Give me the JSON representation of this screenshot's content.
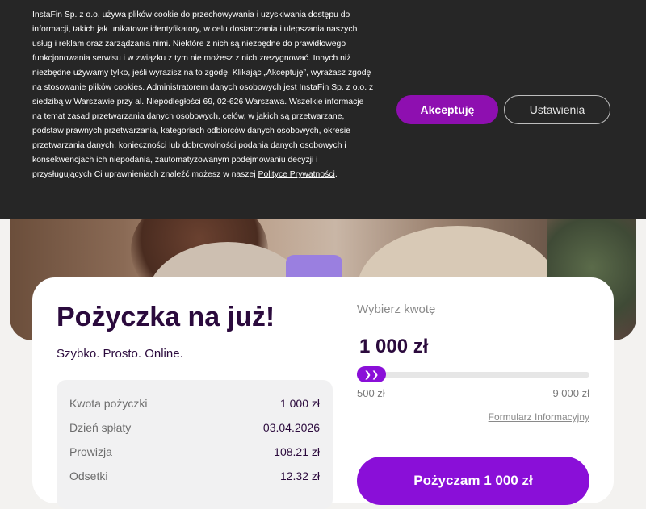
{
  "cookie_banner": {
    "text": "InstaFin Sp. z o.o. używa plików cookie do przechowywania i uzyskiwania dostępu do informacji, takich jak unikatowe identyfikatory, w celu dostarczania i ulepszania naszych usług i reklam oraz zarządzania nimi. Niektóre z nich są niezbędne do prawidłowego funkcjonowania serwisu i w związku z tym nie możesz z nich zrezygnować. Innych niż niezbędne używamy tylko, jeśli wyrazisz na to zgodę. Klikając „Akceptuję”, wyrażasz zgodę na stosowanie plików cookies. Administratorem danych osobowych jest InstaFin Sp. z o.o. z siedzibą w Warszawie przy al. Niepodległości 69, 02-626 Warszawa. Wszelkie informacje na temat zasad przetwarzania danych osobowych, celów, w jakich są przetwarzane, podstaw prawnych przetwarzania, kategoriach odbiorców danych osobowych, okresie przetwarzania danych, konieczności lub dobrowolności podania danych osobowych i konsekwencjach ich niepodania, zautomatyzowanym podejmowaniu decyzji i przysługujących Ci uprawnieniach znaleźć możesz w naszej",
    "policy_link": "Polityce Prywatności",
    "policy_suffix": ".",
    "accept_label": "Akceptuję",
    "settings_label": "Ustawienia"
  },
  "hero": {
    "title": "Pożyczka na już!",
    "subtitle": "Szybko. Prosto. Online."
  },
  "summary": {
    "rows": [
      {
        "label": "Kwota pożyczki",
        "value": "1 000 zł"
      },
      {
        "label": "Dzień spłaty",
        "value": "03.04.2026"
      },
      {
        "label": "Prowizja",
        "value": "108.21 zł"
      },
      {
        "label": "Odsetki",
        "value": "12.32 zł"
      }
    ]
  },
  "calculator": {
    "choose_label": "Wybierz kwotę",
    "amount": "1 000 zł",
    "slider_fraction": 0.0,
    "min_label": "500 zł",
    "max_label": "9 000 zł",
    "info_link": "Formularz Informacyjny",
    "cta_label": "Pożyczam 1 000 zł",
    "accent_color": "#8a0fd8"
  }
}
